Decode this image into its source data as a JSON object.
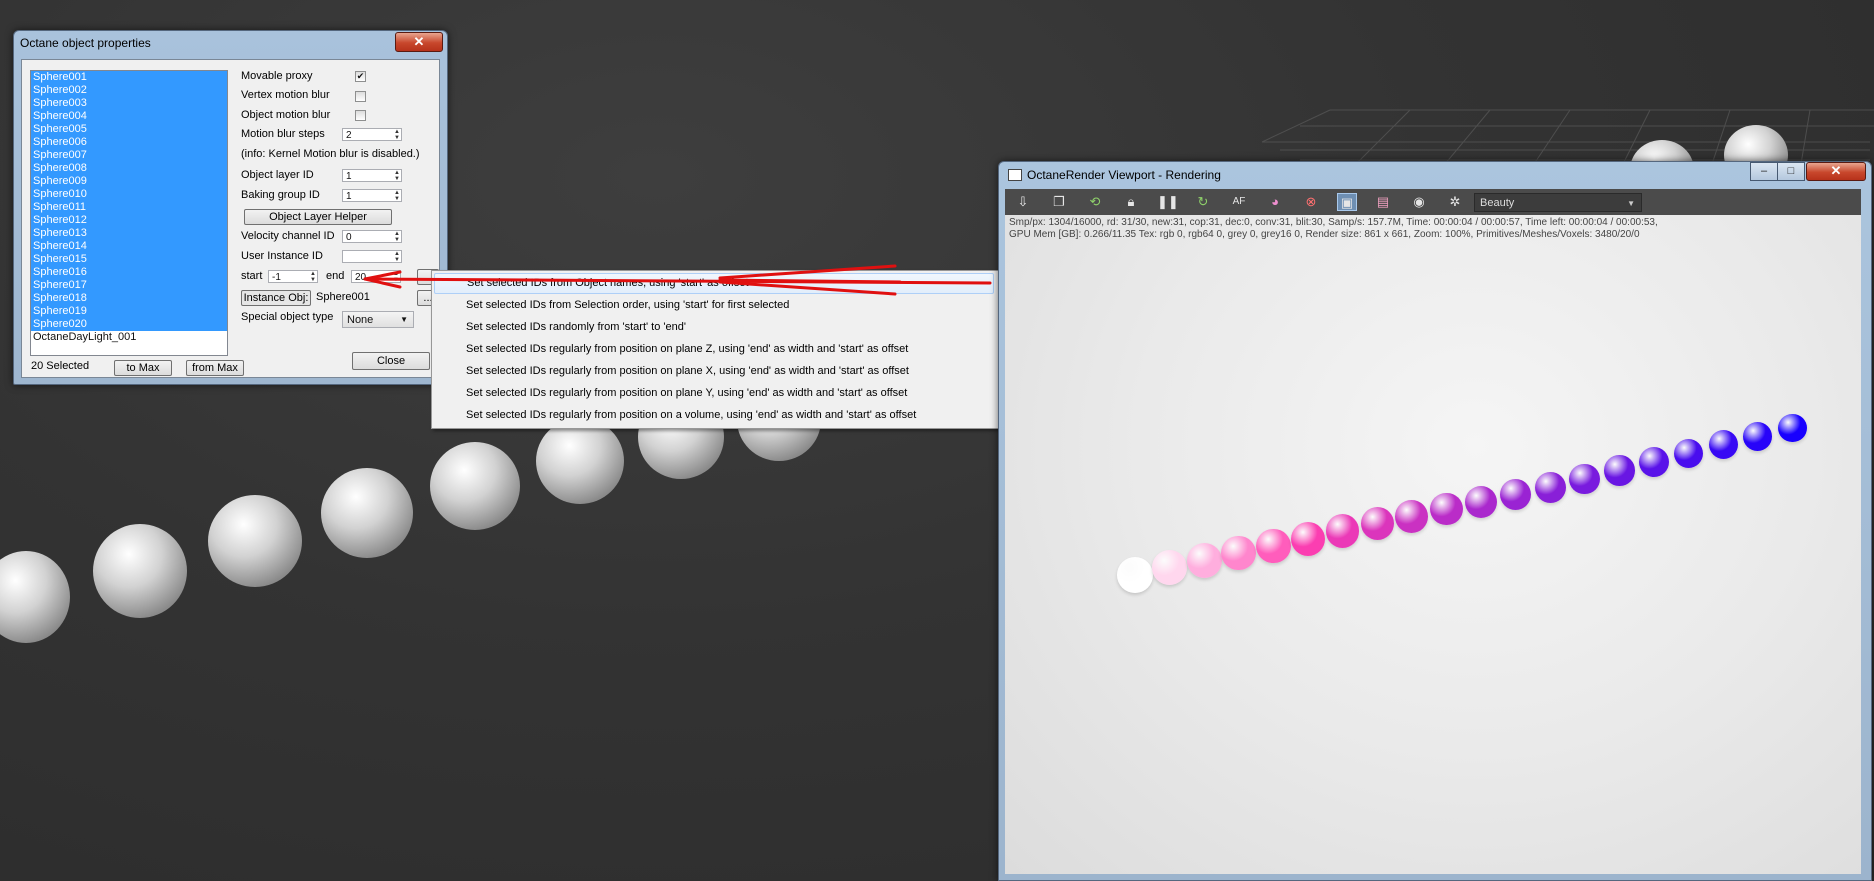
{
  "dialog": {
    "title": "Octane object properties",
    "close_glyph": "✕",
    "objects": [
      "Sphere001",
      "Sphere002",
      "Sphere003",
      "Sphere004",
      "Sphere005",
      "Sphere006",
      "Sphere007",
      "Sphere008",
      "Sphere009",
      "Sphere010",
      "Sphere011",
      "Sphere012",
      "Sphere013",
      "Sphere014",
      "Sphere015",
      "Sphere016",
      "Sphere017",
      "Sphere018",
      "Sphere019",
      "Sphere020"
    ],
    "extra_object": "OctaneDayLight_001",
    "selected_count": "20 Selected",
    "to_max": "to Max",
    "from_max": "from Max",
    "movable_proxy": "Movable proxy",
    "movable_proxy_checked": "✔",
    "vertex_motion_blur": "Vertex motion blur",
    "object_motion_blur": "Object motion blur",
    "motion_blur_steps": "Motion blur steps",
    "motion_blur_steps_value": "2",
    "info": "(info: Kernel Motion blur is disabled.)",
    "object_layer_id": "Object layer ID",
    "object_layer_id_value": "1",
    "baking_group_id": "Baking group ID",
    "baking_group_id_value": "1",
    "object_layer_helper": "Object Layer Helper",
    "velocity_channel_id": "Velocity channel ID",
    "velocity_channel_id_value": "0",
    "user_instance_id": "User Instance ID",
    "user_instance_id_value": "",
    "start_label": "start",
    "start_value": "-1",
    "end_label": "end",
    "end_value": "20",
    "more_button": "...",
    "instance_obj_label": "Instance Obj:",
    "instance_obj_value": "Sphere001",
    "special_object_type": "Special object type",
    "special_object_type_value": "None",
    "close_button": "Close"
  },
  "menu": {
    "items": [
      "Set selected IDs from Object names, using 'start' as offset",
      "Set selected IDs from Selection order, using 'start' for first selected",
      "Set selected IDs randomly from 'start' to 'end'",
      "Set selected IDs regularly from position on plane Z, using 'end' as width and 'start' as offset",
      "Set selected IDs regularly from position on plane X, using 'end' as width and 'start' as offset",
      "Set selected IDs regularly from position on plane Y, using 'end' as width and 'start' as offset",
      "Set selected IDs regularly from position on a volume, using 'end' as width and 'start' as offset"
    ]
  },
  "viewport": {
    "title": "OctaneRender Viewport - Rendering",
    "pass": "Beauty",
    "stats_line1": "Smp/px: 1304/16000,   rd: 31/30,   new:31, cop:31, dec:0, conv:31, blit:30,   Samp/s: 157.7M,   Time: 00:00:04 / 00:00:57,   Time left: 00:00:04 / 00:00:53,",
    "stats_line2": "GPU Mem [GB]: 0.266/11.35   Tex: rgb 0, rgb64 0, grey 0, grey16 0,   Render size: 861 x 661,   Zoom: 100%,   Primitives/Meshes/Voxels: 3480/20/0",
    "toolbar_icons": [
      "export-icon",
      "copy-icon",
      "restart-icon",
      "lock-icon",
      "pause-icon",
      "refresh-icon",
      "af-icon",
      "color-icon",
      "settings-cross-icon",
      "region-icon",
      "film-icon",
      "camera-icon",
      "gear-icon"
    ]
  },
  "accent": {
    "selection": "#3399ff",
    "arrow": "#e01010",
    "ball_start": "#ffffff",
    "ball_mid": "#ff3fb0",
    "ball_end": "#1800ff"
  }
}
